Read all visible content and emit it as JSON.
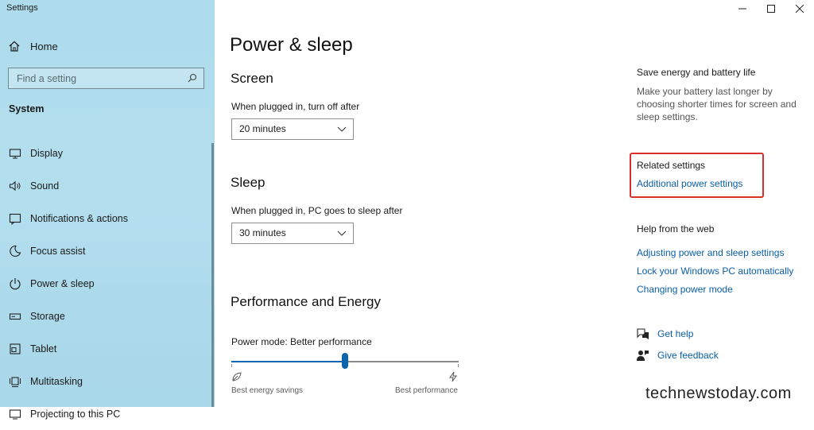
{
  "window": {
    "title": "Settings"
  },
  "sidebar": {
    "home_label": "Home",
    "search_placeholder": "Find a setting",
    "section_title": "System",
    "items": [
      {
        "label": "Display",
        "icon": "display-icon"
      },
      {
        "label": "Sound",
        "icon": "speaker-icon"
      },
      {
        "label": "Notifications & actions",
        "icon": "notification-icon"
      },
      {
        "label": "Focus assist",
        "icon": "moon-icon"
      },
      {
        "label": "Power & sleep",
        "icon": "power-icon"
      },
      {
        "label": "Storage",
        "icon": "storage-icon"
      },
      {
        "label": "Tablet",
        "icon": "tablet-icon"
      },
      {
        "label": "Multitasking",
        "icon": "multitasking-icon"
      },
      {
        "label": "Projecting to this PC",
        "icon": "projecting-icon"
      }
    ]
  },
  "main": {
    "title": "Power & sleep",
    "screen": {
      "heading": "Screen",
      "label": "When plugged in, turn off after",
      "value": "20 minutes"
    },
    "sleep": {
      "heading": "Sleep",
      "label": "When plugged in, PC goes to sleep after",
      "value": "30 minutes"
    },
    "performance": {
      "heading": "Performance and Energy",
      "label": "Power mode: Better performance",
      "slider_value": 0.5,
      "left_caption": "Best energy savings",
      "right_caption": "Best performance"
    }
  },
  "right": {
    "save_heading": "Save energy and battery life",
    "save_text": "Make your battery last longer by choosing shorter times for screen and sleep settings.",
    "related_heading": "Related settings",
    "related_link": "Additional power settings",
    "help_heading": "Help from the web",
    "help_links": [
      "Adjusting power and sleep settings",
      "Lock your Windows PC automatically",
      "Changing power mode"
    ],
    "get_help": "Get help",
    "give_feedback": "Give feedback"
  },
  "watermark": "technewstoday.com",
  "colors": {
    "accent": "#0a64ad",
    "link": "#0a5ea6",
    "sidebar_bg": "#b0dced",
    "highlight_box": "#d9302c"
  }
}
